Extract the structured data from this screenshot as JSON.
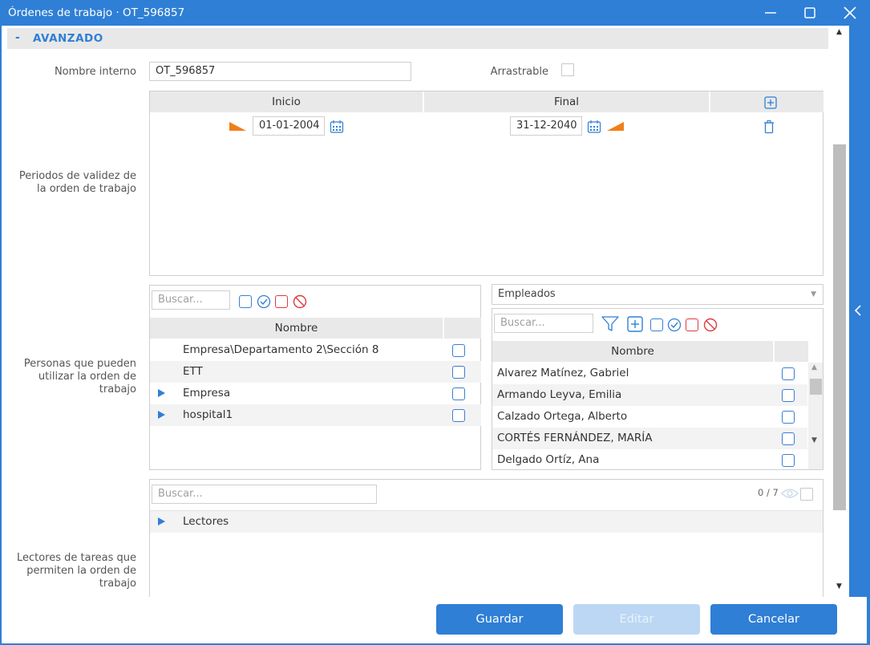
{
  "window": {
    "title": "Órdenes de trabajo · OT_596857"
  },
  "section": {
    "toggle": "-",
    "title": "AVANZADO"
  },
  "fields": {
    "internal_name_label": "Nombre interno",
    "internal_name_value": "OT_596857",
    "draggable_label": "Arrastrable",
    "validity_label": "Periodos de validez de la orden de trabajo",
    "persons_label": "Personas que pueden utilizar la orden de trabajo",
    "readers_label": "Lectores de tareas que permiten la orden de trabajo"
  },
  "validity_table": {
    "columns": [
      "Inicio",
      "Final"
    ],
    "start_date": "01-01-2004",
    "end_date": "31-12-2040"
  },
  "groups_panel": {
    "search_placeholder": "Buscar...",
    "column": "Nombre",
    "rows": [
      {
        "label": "Empresa\\Departamento 2\\Sección 8",
        "expandable": false
      },
      {
        "label": "ETT",
        "expandable": false
      },
      {
        "label": "Empresa",
        "expandable": true
      },
      {
        "label": "hospital1",
        "expandable": true
      }
    ]
  },
  "employees_panel": {
    "dropdown_value": "Empleados",
    "search_placeholder": "Buscar...",
    "column": "Nombre",
    "rows": [
      "Alvarez Matínez, Gabriel",
      "Armando Leyva, Emilia",
      "Calzado Ortega, Alberto",
      "CORTÉS FERNÁNDEZ, MARÍA",
      "Delgado Ortíz, Ana"
    ]
  },
  "readers_panel": {
    "search_placeholder": "Buscar...",
    "counter": "0 / 7",
    "rows": [
      {
        "label": "Lectores",
        "expandable": true
      }
    ]
  },
  "footer": {
    "save": "Guardar",
    "edit": "Editar",
    "cancel": "Cancelar"
  },
  "colors": {
    "accent": "#2f7fd6",
    "orange": "#f07f1a",
    "red": "#e0393e",
    "disabled": "#bcd7f3"
  }
}
